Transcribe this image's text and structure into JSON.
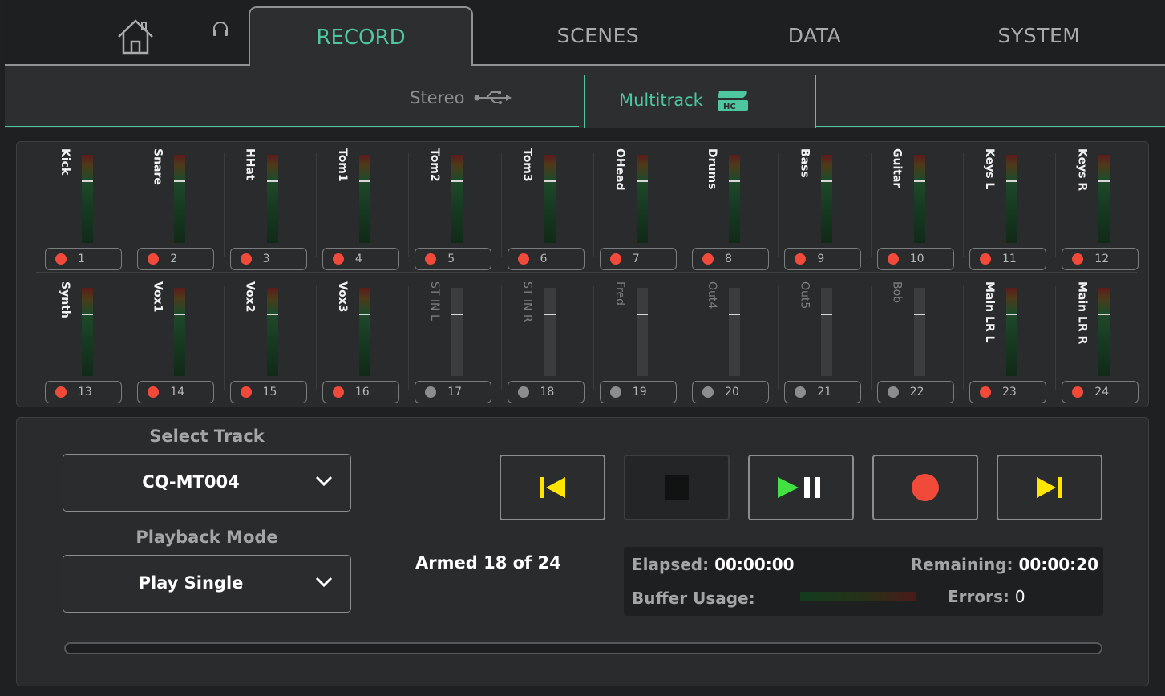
{
  "tabs": {
    "home_icon": "home-icon",
    "headphones_icon": "headphones-icon",
    "record": "RECORD",
    "scenes": "SCENES",
    "data": "DATA",
    "system": "SYSTEM",
    "active": "RECORD"
  },
  "subtabs": {
    "stereo": "Stereo",
    "stereo_icon": "usb-icon",
    "multitrack": "Multitrack",
    "multitrack_icon": "sd-hc-card-icon",
    "active": "Multitrack"
  },
  "channels": [
    {
      "name": "Kick",
      "num": "1",
      "armed": true
    },
    {
      "name": "Snare",
      "num": "2",
      "armed": true
    },
    {
      "name": "HHat",
      "num": "3",
      "armed": true
    },
    {
      "name": "Tom1",
      "num": "4",
      "armed": true
    },
    {
      "name": "Tom2",
      "num": "5",
      "armed": true
    },
    {
      "name": "Tom3",
      "num": "6",
      "armed": true
    },
    {
      "name": "OHead",
      "num": "7",
      "armed": true
    },
    {
      "name": "Drums",
      "num": "8",
      "armed": true
    },
    {
      "name": "Bass",
      "num": "9",
      "armed": true
    },
    {
      "name": "Guitar",
      "num": "10",
      "armed": true
    },
    {
      "name": "Keys L",
      "num": "11",
      "armed": true
    },
    {
      "name": "Keys R",
      "num": "12",
      "armed": true
    },
    {
      "name": "Synth",
      "num": "13",
      "armed": true
    },
    {
      "name": "Vox1",
      "num": "14",
      "armed": true
    },
    {
      "name": "Vox2",
      "num": "15",
      "armed": true
    },
    {
      "name": "Vox3",
      "num": "16",
      "armed": true
    },
    {
      "name": "ST IN L",
      "num": "17",
      "armed": false
    },
    {
      "name": "ST IN R",
      "num": "18",
      "armed": false
    },
    {
      "name": "Fred",
      "num": "19",
      "armed": false
    },
    {
      "name": "Out4",
      "num": "20",
      "armed": false
    },
    {
      "name": "Out5",
      "num": "21",
      "armed": false
    },
    {
      "name": "Bob",
      "num": "22",
      "armed": false
    },
    {
      "name": "Main LR L",
      "num": "23",
      "armed": true
    },
    {
      "name": "Main LR R",
      "num": "24",
      "armed": true
    }
  ],
  "select_track": {
    "label": "Select Track",
    "value": "CQ-MT004"
  },
  "playback_mode": {
    "label": "Playback Mode",
    "value": "Play Single"
  },
  "transport": {
    "buttons": [
      "skip-back",
      "stop",
      "play-pause",
      "record",
      "skip-forward"
    ]
  },
  "status": {
    "armed": "Armed 18 of 24",
    "elapsed_label": "Elapsed:",
    "elapsed_value": "00:00:00",
    "remaining_label": "Remaining:",
    "remaining_value": "00:00:20",
    "buffer_label": "Buffer Usage:",
    "errors_label": "Errors:",
    "errors_value": "0"
  },
  "colors": {
    "accent": "#4ec7a1",
    "armed_dot": "#f24a3a",
    "transport_yellow": "#ffe500",
    "play_green": "#42e043"
  },
  "playback_progress": 0
}
